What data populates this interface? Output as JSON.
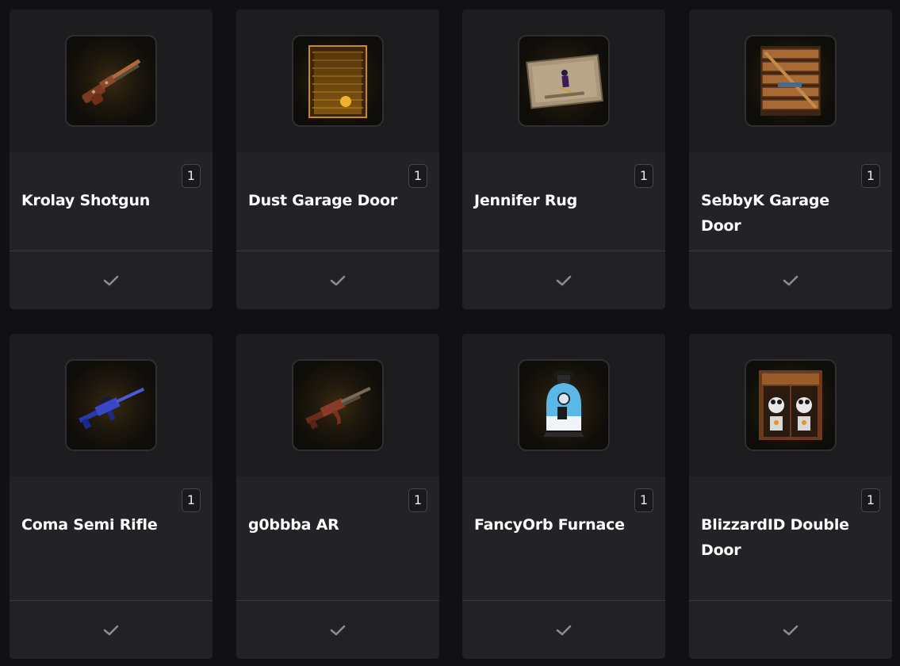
{
  "items": [
    {
      "name": "Krolay Shotgun",
      "quantity": "1",
      "icon": "shotgun-icon"
    },
    {
      "name": "Dust Garage Door",
      "quantity": "1",
      "icon": "garage-door-icon"
    },
    {
      "name": "Jennifer Rug",
      "quantity": "1",
      "icon": "rug-icon"
    },
    {
      "name": "SebbyK Garage Door",
      "quantity": "1",
      "icon": "wooden-garage-door-icon"
    },
    {
      "name": "Coma Semi Rifle",
      "quantity": "1",
      "icon": "semi-rifle-icon"
    },
    {
      "name": "g0bbba AR",
      "quantity": "1",
      "icon": "assault-rifle-icon"
    },
    {
      "name": "FancyOrb Furnace",
      "quantity": "1",
      "icon": "furnace-icon"
    },
    {
      "name": "BlizzardID Double Door",
      "quantity": "1",
      "icon": "double-door-icon"
    }
  ],
  "colors": {
    "page_background": "#111113",
    "card_background": "#222226",
    "check_color": "#8a8a90"
  }
}
